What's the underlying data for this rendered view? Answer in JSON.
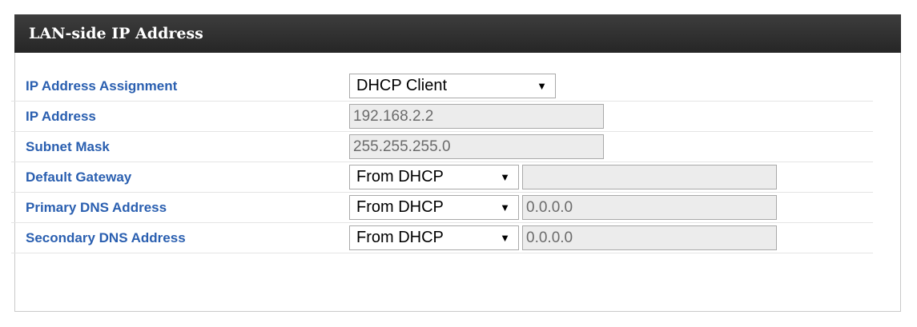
{
  "panel": {
    "title": "LAN-side IP Address"
  },
  "rows": {
    "ip_assignment": {
      "label": "IP Address Assignment",
      "select_value": "DHCP Client",
      "arrow": "▼"
    },
    "ip_address": {
      "label": "IP Address",
      "value": "192.168.2.2"
    },
    "subnet_mask": {
      "label": "Subnet Mask",
      "value": "255.255.255.0"
    },
    "default_gateway": {
      "label": "Default Gateway",
      "select_value": "From DHCP",
      "arrow": "▼",
      "value": ""
    },
    "primary_dns": {
      "label": "Primary DNS Address",
      "select_value": "From DHCP",
      "arrow": "▼",
      "value": "0.0.0.0"
    },
    "secondary_dns": {
      "label": "Secondary DNS Address",
      "select_value": "From DHCP",
      "arrow": "▼",
      "value": "0.0.0.0"
    }
  },
  "colors": {
    "header_bg": "#2f2f2f",
    "label_blue": "#2a5fb0",
    "disabled_field": "#ececec"
  }
}
